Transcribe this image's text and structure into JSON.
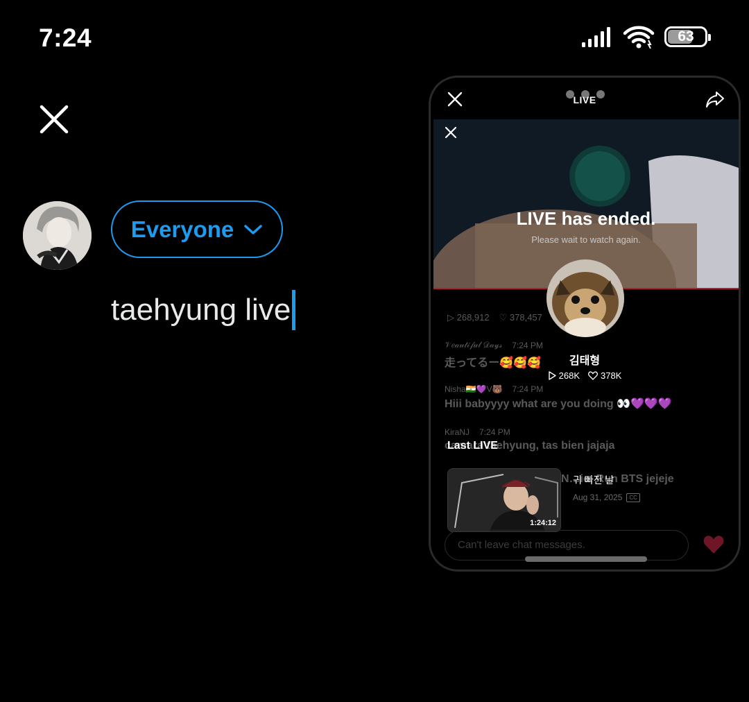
{
  "status": {
    "time": "7:24",
    "battery": "63"
  },
  "composer": {
    "audience_label": "Everyone",
    "text": "taehyung live"
  },
  "card": {
    "header_label": "LIVE",
    "ended_title": "LIVE has ended.",
    "ended_subtitle": "Please wait to watch again.",
    "profile": {
      "name": "김태형",
      "views": "268K",
      "likes": "378K"
    },
    "chat_stats": {
      "views": "268,912",
      "likes": "378,457"
    },
    "messages": [
      {
        "user": "𝒱𝑒𝒶𝓊𝓉𝒾𝒻𝓊𝓁 𝒟𝒶𝓎𝓈",
        "time": "7:24 PM",
        "text": "走ってるー🥰🥰🥰"
      },
      {
        "user": "Nisha🇮🇳💜V🐻",
        "time": "7:24 PM",
        "text": "Hiii babyyyy what are you doing 👀💜💜💜"
      },
      {
        "user": "KiraNJ",
        "time": "7:24 PM",
        "text": "camara taehyung, tas bien jajaja"
      },
      {
        "user": "L",
        "time": "",
        "text": "N…io, Run BTS jejeje"
      }
    ],
    "last_live": {
      "heading": "Last LIVE",
      "title": "귀 빠진 날",
      "date": "Aug 31, 2025",
      "duration": "1:24:12",
      "cc": "CC"
    },
    "chat_placeholder": "Can't leave chat messages."
  }
}
